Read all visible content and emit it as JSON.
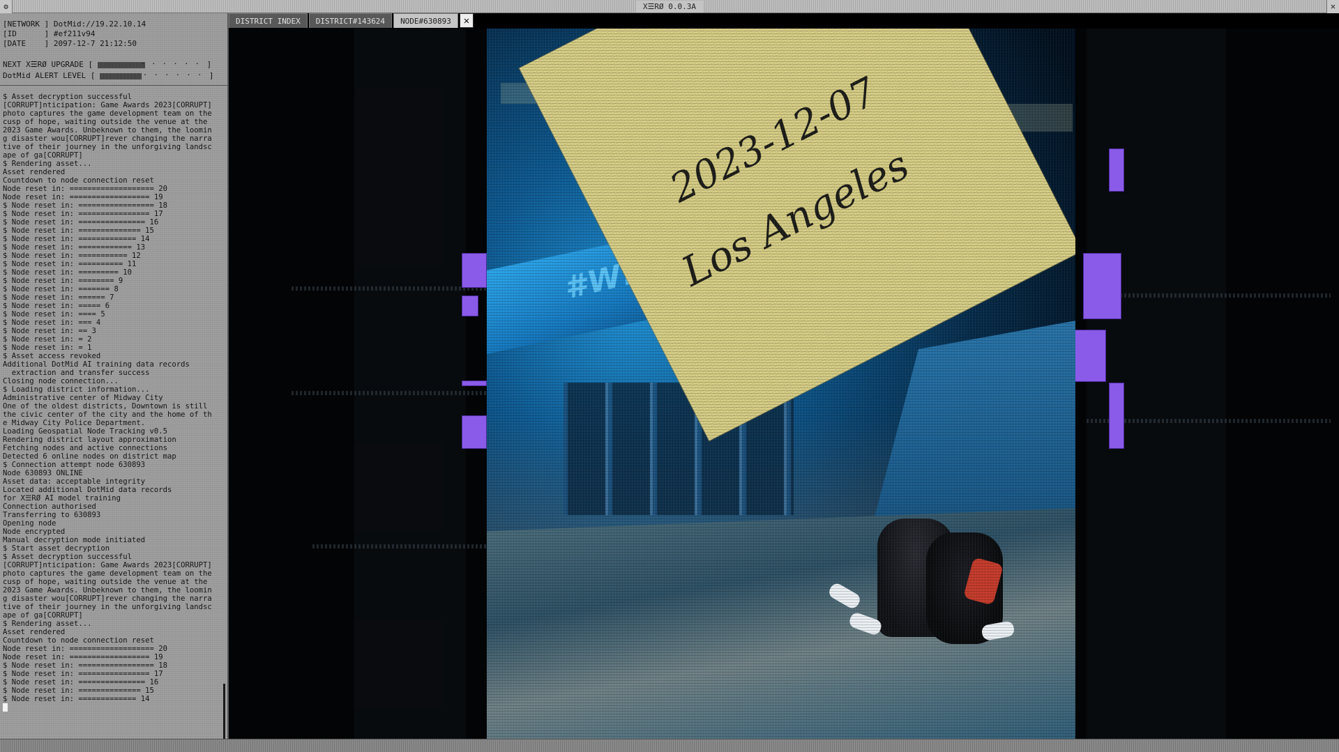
{
  "window": {
    "title": "X☰RØ 0.0.3A",
    "menu_icon": "gear-icon",
    "close_icon": "close-icon"
  },
  "status": {
    "network": "[NETWORK ] DotMid://19.22.10.14",
    "id": "[ID      ] #ef211v94",
    "date": "[DATE    ] 2097-12-7 21:12:50"
  },
  "meters": {
    "upgrade_label": "NEXT X☰RØ UPGRADE [",
    "upgrade_level": 0.45,
    "alert_label": "DotMid ALERT LEVEL [",
    "alert_level": 0.4
  },
  "tabs": [
    {
      "label": "DISTRICT INDEX"
    },
    {
      "label": "DISTRICT#143624"
    },
    {
      "label": "NODE#630893"
    }
  ],
  "tab_close": "✕",
  "log": [
    "$ Asset decryption successful",
    "[CORRUPT]nticipation: Game Awards 2023[CORRUPT]photo captures the game development team on the cusp of hope, waiting outside the venue at the 2023 Game Awards. Unbeknown to them, the looming disaster wou[CORRUPT]rever changing the narrative of their journey in the unforgiving landscape of ga[CORRUPT]",
    "$ Rendering asset...",
    "Asset rendered",
    "Countdown to node connection reset",
    "Node reset in: =================== 20",
    "Node reset in: ================== 19",
    "$ Node reset in: ================= 18",
    "$ Node reset in: ================ 17",
    "$ Node reset in: =============== 16",
    "$ Node reset in: ============== 15",
    "$ Node reset in: ============= 14",
    "$ Node reset in: ============ 13",
    "$ Node reset in: =========== 12",
    "$ Node reset in: ========== 11",
    "$ Node reset in: ========= 10",
    "$ Node reset in: ======== 9",
    "$ Node reset in: ======= 8",
    "$ Node reset in: ====== 7",
    "$ Node reset in: ===== 6",
    "$ Node reset in: ==== 5",
    "$ Node reset in: === 4",
    "$ Node reset in: == 3",
    "$ Node reset in: = 2",
    "$ Node reset in: = 1",
    "$ Asset access revoked",
    "Additional DotMid AI training data records",
    "  extraction and transfer success",
    "Closing node connection...",
    "$ Loading district information...",
    "Administrative center of Midway City",
    "One of the oldest districts, Downtown is still the civic center of the city and the home of the Midway City Police Department.",
    "Loading Geospatial Node Tracking v0.5",
    "Rendering district layout approximation",
    "Fetching nodes and active connections",
    "Detected 6 online nodes on district map",
    "$ Connection attempt node 630893",
    "Node 630893 ONLINE",
    "Asset data: acceptable integrity",
    "Located additional DotMid data records",
    "for X☰RØ AI model training",
    "Connection authorised",
    "Transferring to 630893",
    "Opening node",
    "Node encrypted",
    "Manual decryption mode initiated",
    "$ Start asset decryption",
    "$ Asset decryption successful",
    "[CORRUPT]nticipation: Game Awards 2023[CORRUPT]photo captures the game development team on the cusp of hope, waiting outside the venue at the 2023 Game Awards. Unbeknown to them, the looming disaster wou[CORRUPT]rever changing the narrative of their journey in the unforgiving landscape of ga[CORRUPT]",
    "$ Rendering asset...",
    "Asset rendered",
    "Countdown to node connection reset",
    "Node reset in: =================== 20",
    "Node reset in: ================== 19",
    "$ Node reset in: ================= 18",
    "$ Node reset in: ================ 17",
    "$ Node reset in: =============== 16",
    "$ Node reset in: ============== 15",
    "$ Node reset in: ============= 14"
  ],
  "photo": {
    "note_date": "2023-12-07",
    "note_city": "Los Angeles",
    "banner_text": "#WITH"
  },
  "colors": {
    "panel_bg": "#9c9c9c",
    "glitch_purple": "#8a5be8",
    "note_yellow": "#d8cf86",
    "venue_blue": "#1f8fd2"
  }
}
